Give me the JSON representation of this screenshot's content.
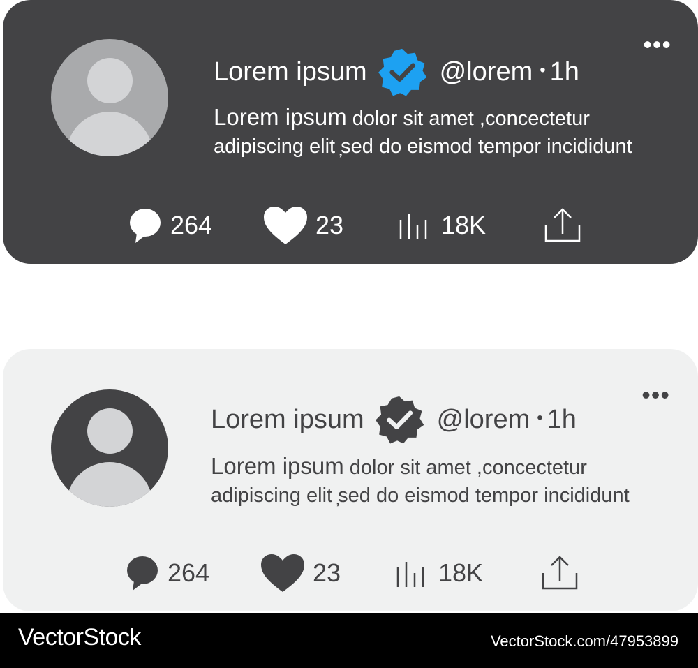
{
  "cards": [
    {
      "theme": "dark",
      "name": "Lorem ipsum",
      "handle": "@lorem",
      "dot": "•",
      "time": "1h",
      "more": "•••",
      "body_lead": "Lorem ipsum",
      "body_rest": " dolor sit amet ,concectetur adipiscing elit ̦sed do eismod tempor incididunt",
      "comments": "264",
      "likes": "23",
      "views": "18K",
      "badge_color": "#1da1f2"
    },
    {
      "theme": "light",
      "name": "Lorem ipsum",
      "handle": "@lorem",
      "dot": "•",
      "time": "1h",
      "more": "•••",
      "body_lead": "Lorem ipsum",
      "body_rest": " dolor sit amet ,concectetur adipiscing elit ̦sed do eismod tempor incididunt",
      "comments": "264",
      "likes": "23",
      "views": "18K",
      "badge_color": "#434345"
    }
  ],
  "footer": {
    "brand": "VectorStock",
    "url": "VectorStock.com/47953899"
  },
  "icons": [
    "comment-icon",
    "heart-icon",
    "views-icon",
    "share-icon",
    "verified-badge-icon",
    "more-icon",
    "avatar-placeholder-icon"
  ]
}
